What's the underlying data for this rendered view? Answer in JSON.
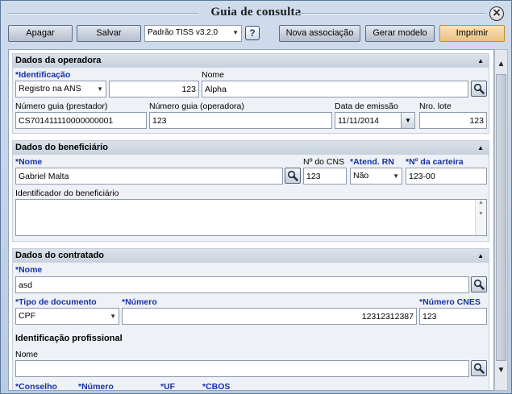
{
  "window": {
    "title": "Guia de consulta",
    "close_icon": "close-circle-icon"
  },
  "toolbar": {
    "apagar": "Apagar",
    "salvar": "Salvar",
    "template_select": "Padrão TISS v3.2.0",
    "help": "?",
    "nova_associacao": "Nova associação",
    "gerar_modelo": "Gerar modelo",
    "imprimir": "Imprimir"
  },
  "operadora": {
    "section_title": "Dados da operadora",
    "identificacao_label": "*Identificação",
    "identificacao_type": "Registro na ANS",
    "identificacao_value": "123",
    "nome_label": "Nome",
    "nome_value": "Alpha",
    "numero_guia_prestador_label": "Número guia (prestador)",
    "numero_guia_prestador_value": "CS701411110000000001",
    "numero_guia_operadora_label": "Número guia (operadora)",
    "numero_guia_operadora_value": "123",
    "data_emissao_label": "Data de emissão",
    "data_emissao_value": "11/11/2014",
    "nro_lote_label": "Nro. lote",
    "nro_lote_value": "123"
  },
  "beneficiario": {
    "section_title": "Dados do beneficiário",
    "nome_label": "*Nome",
    "nome_value": "Gabriel Malta",
    "cns_label": "Nº do CNS",
    "cns_value": "123",
    "atend_rn_label": "*Atend. RN",
    "atend_rn_value": "Não",
    "carteira_label": "*Nº da carteira",
    "carteira_value": "123-00",
    "identificador_label": "Identificador do beneficiário"
  },
  "contratado": {
    "section_title": "Dados do contratado",
    "nome_label": "*Nome",
    "nome_value": "asd",
    "tipo_doc_label": "*Tipo de documento",
    "tipo_doc_value": "CPF",
    "numero_label": "*Número",
    "numero_value": "12312312387",
    "cnes_label": "*Número CNES",
    "cnes_value": "123",
    "identificacao_profissional": "Identificação profissional",
    "prof_nome_label": "Nome",
    "conselho_label": "*Conselho",
    "prof_numero_label": "*Número",
    "uf_label": "*UF",
    "cbos_label": "*CBOS"
  }
}
